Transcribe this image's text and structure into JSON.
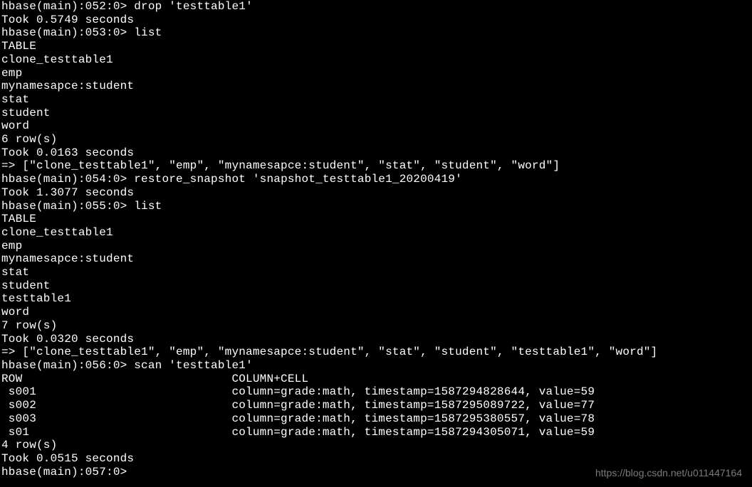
{
  "terminal": {
    "lines": [
      {
        "prompt": "hbase(main):052:0>",
        "cmd": " drop 'testtable1'",
        "out": null
      },
      {
        "prompt": null,
        "cmd": null,
        "out": "Took 0.5749 seconds"
      },
      {
        "prompt": "hbase(main):053:0>",
        "cmd": " list",
        "out": null
      },
      {
        "prompt": null,
        "cmd": null,
        "out": "TABLE"
      },
      {
        "prompt": null,
        "cmd": null,
        "out": "clone_testtable1"
      },
      {
        "prompt": null,
        "cmd": null,
        "out": "emp"
      },
      {
        "prompt": null,
        "cmd": null,
        "out": "mynamesapce:student"
      },
      {
        "prompt": null,
        "cmd": null,
        "out": "stat"
      },
      {
        "prompt": null,
        "cmd": null,
        "out": "student"
      },
      {
        "prompt": null,
        "cmd": null,
        "out": "word"
      },
      {
        "prompt": null,
        "cmd": null,
        "out": "6 row(s)"
      },
      {
        "prompt": null,
        "cmd": null,
        "out": "Took 0.0163 seconds"
      },
      {
        "prompt": null,
        "cmd": null,
        "out": "=> [\"clone_testtable1\", \"emp\", \"mynamesapce:student\", \"stat\", \"student\", \"word\"]"
      },
      {
        "prompt": "hbase(main):054:0>",
        "cmd": " restore_snapshot 'snapshot_testtable1_20200419'",
        "out": null
      },
      {
        "prompt": null,
        "cmd": null,
        "out": "Took 1.3077 seconds"
      },
      {
        "prompt": "hbase(main):055:0>",
        "cmd": " list",
        "out": null
      },
      {
        "prompt": null,
        "cmd": null,
        "out": "TABLE"
      },
      {
        "prompt": null,
        "cmd": null,
        "out": "clone_testtable1"
      },
      {
        "prompt": null,
        "cmd": null,
        "out": "emp"
      },
      {
        "prompt": null,
        "cmd": null,
        "out": "mynamesapce:student"
      },
      {
        "prompt": null,
        "cmd": null,
        "out": "stat"
      },
      {
        "prompt": null,
        "cmd": null,
        "out": "student"
      },
      {
        "prompt": null,
        "cmd": null,
        "out": "testtable1"
      },
      {
        "prompt": null,
        "cmd": null,
        "out": "word"
      },
      {
        "prompt": null,
        "cmd": null,
        "out": "7 row(s)"
      },
      {
        "prompt": null,
        "cmd": null,
        "out": "Took 0.0320 seconds"
      },
      {
        "prompt": null,
        "cmd": null,
        "out": "=> [\"clone_testtable1\", \"emp\", \"mynamesapce:student\", \"stat\", \"student\", \"testtable1\", \"word\"]"
      },
      {
        "prompt": "hbase(main):056:0>",
        "cmd": " scan 'testtable1'",
        "out": null
      },
      {
        "prompt": null,
        "cmd": null,
        "out": "ROW                              COLUMN+CELL"
      },
      {
        "prompt": null,
        "cmd": null,
        "out": " s001                            column=grade:math, timestamp=1587294828644, value=59"
      },
      {
        "prompt": null,
        "cmd": null,
        "out": " s002                            column=grade:math, timestamp=1587295089722, value=77"
      },
      {
        "prompt": null,
        "cmd": null,
        "out": " s003                            column=grade:math, timestamp=1587295380557, value=78"
      },
      {
        "prompt": null,
        "cmd": null,
        "out": " s01                             column=grade:math, timestamp=1587294305071, value=59"
      },
      {
        "prompt": null,
        "cmd": null,
        "out": "4 row(s)"
      },
      {
        "prompt": null,
        "cmd": null,
        "out": "Took 0.0515 seconds"
      },
      {
        "prompt": "hbase(main):057:0>",
        "cmd": "",
        "out": null
      }
    ]
  },
  "watermark": "https://blog.csdn.net/u011447164"
}
